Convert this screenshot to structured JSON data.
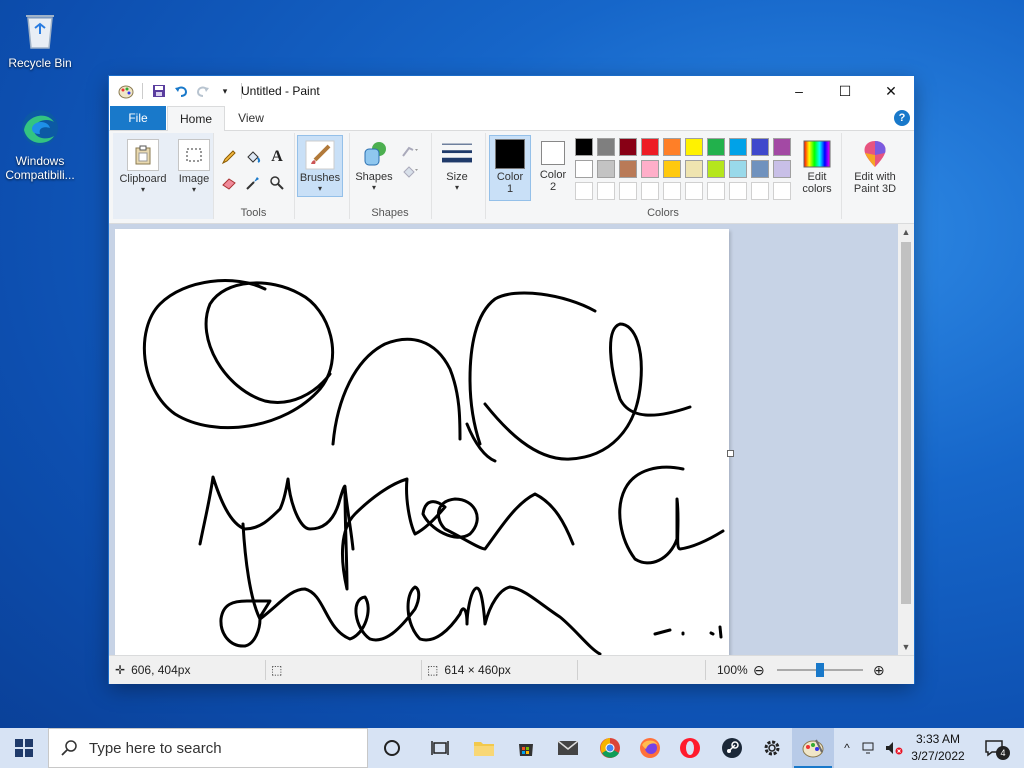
{
  "desktop": {
    "icons": [
      {
        "label": "Recycle Bin"
      },
      {
        "label": "Windows Compatibili..."
      }
    ]
  },
  "window": {
    "title": "Untitled - Paint",
    "tabs": {
      "file": "File",
      "home": "Home",
      "view": "View"
    },
    "help": "?"
  },
  "ribbon": {
    "clipboard": "Clipboard",
    "image": "Image",
    "tools": "Tools",
    "brushes": "Brushes",
    "shapes_btn": "Shapes",
    "shapes_group": "Shapes",
    "size": "Size",
    "color1": "Color\n1",
    "color1_a": "Color",
    "color1_b": "1",
    "color2_a": "Color",
    "color2_b": "2",
    "colors_group": "Colors",
    "edit_colors_a": "Edit",
    "edit_colors_b": "colors",
    "paint3d_a": "Edit with",
    "paint3d_b": "Paint 3D",
    "palette_row1": [
      "#000000",
      "#7f7f7f",
      "#880015",
      "#ed1c24",
      "#ff7f27",
      "#fff200",
      "#22b14c",
      "#00a2e8",
      "#3f48cc",
      "#a349a4"
    ],
    "palette_row2": [
      "#ffffff",
      "#c3c3c3",
      "#b97a57",
      "#ffaec9",
      "#ffc90e",
      "#efe4b0",
      "#b5e61d",
      "#99d9ea",
      "#7092be",
      "#c8bfe7"
    ]
  },
  "status": {
    "cursor_pos": "606, 404px",
    "canvas_size": "614 × 460px",
    "zoom": "100%",
    "zoom_fraction": 0.5
  },
  "taskbar": {
    "search_placeholder": "Type here to search",
    "time": "3:33 AM",
    "date": "3/27/2022",
    "notifications": "4"
  }
}
